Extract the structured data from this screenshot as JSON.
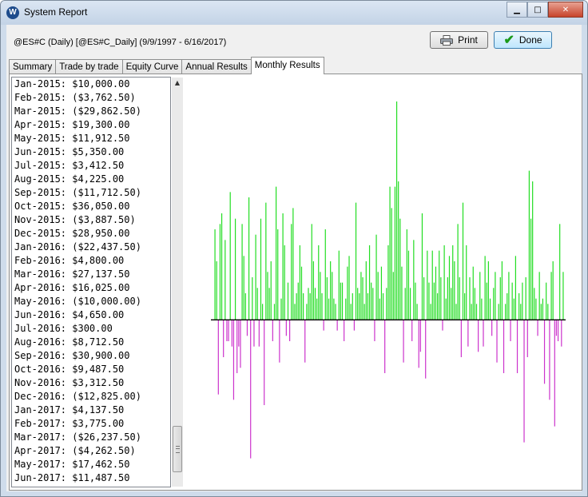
{
  "window": {
    "title": "System Report",
    "app_icon_letter": "W",
    "minimize_glyph": "▁",
    "maximize_glyph": "□",
    "close_glyph": "✕"
  },
  "header": {
    "subtitle": "@ES#C (Daily) [@ES#C_Daily]  (9/9/1997 - 6/16/2017)",
    "print_label": "Print",
    "done_label": "Done"
  },
  "tabs": [
    {
      "label": "Summary",
      "active": false
    },
    {
      "label": "Trade by trade",
      "active": false
    },
    {
      "label": "Equity Curve",
      "active": false
    },
    {
      "label": "Annual Results",
      "active": false
    },
    {
      "label": "Monthly Results",
      "active": true
    }
  ],
  "monthly_list": [
    "Jan-2015: $10,000.00",
    "Feb-2015: ($3,762.50)",
    "Mar-2015: ($29,862.50)",
    "Apr-2015: $19,300.00",
    "May-2015: $11,912.50",
    "Jun-2015: $5,350.00",
    "Jul-2015: $3,412.50",
    "Aug-2015: $4,225.00",
    "Sep-2015: ($11,712.50)",
    "Oct-2015: $36,050.00",
    "Nov-2015: ($3,887.50)",
    "Dec-2015: $28,950.00",
    "Jan-2016: ($22,437.50)",
    "Feb-2016: $4,800.00",
    "Mar-2016: $27,137.50",
    "Apr-2016: $16,025.00",
    "May-2016: ($10,000.00)",
    "Jun-2016: $4,650.00",
    "Jul-2016: $300.00",
    "Aug-2016: $8,712.50",
    "Sep-2016: $30,900.00",
    "Oct-2016: $9,487.50",
    "Nov-2016: $3,312.50",
    "Dec-2016: ($12,825.00)",
    "Jan-2017: $4,137.50",
    "Feb-2017: $3,775.00",
    "Mar-2017: ($26,237.50)",
    "Apr-2017: ($4,262.50)",
    "May-2017: $17,462.50",
    "Jun-2017: $11,487.50"
  ],
  "colors": {
    "positive_bar": "#22dd22",
    "negative_bar": "#cc33cc",
    "axis": "#000000"
  },
  "chart_data": {
    "type": "bar",
    "title": "",
    "xlabel": "",
    "ylabel": "",
    "ylim": [
      -140000,
      205000
    ],
    "grid": false,
    "values": [
      85000,
      55000,
      -70000,
      90000,
      100000,
      -35000,
      75000,
      -20000,
      -20000,
      120000,
      -25000,
      -75000,
      95000,
      -50000,
      -25000,
      -45000,
      90000,
      60000,
      25000,
      -15000,
      115000,
      -130000,
      40000,
      -25000,
      80000,
      30000,
      -25000,
      95000,
      15000,
      -80000,
      110000,
      45000,
      30000,
      55000,
      -20000,
      15000,
      125000,
      85000,
      -40000,
      20000,
      100000,
      70000,
      -15000,
      35000,
      -20000,
      90000,
      105000,
      15000,
      25000,
      35000,
      70000,
      50000,
      25000,
      -40000,
      15000,
      30000,
      25000,
      90000,
      55000,
      30000,
      20000,
      70000,
      45000,
      25000,
      -10000,
      85000,
      40000,
      20000,
      55000,
      45000,
      20000,
      15000,
      -10000,
      65000,
      35000,
      35000,
      -20000,
      20000,
      50000,
      60000,
      15000,
      25000,
      -10000,
      110000,
      30000,
      25000,
      45000,
      40000,
      15000,
      55000,
      25000,
      70000,
      35000,
      30000,
      -20000,
      80000,
      45000,
      20000,
      50000,
      25000,
      -50000,
      30000,
      70000,
      125000,
      105000,
      45000,
      125000,
      205000,
      130000,
      95000,
      50000,
      -40000,
      30000,
      85000,
      65000,
      30000,
      -20000,
      75000,
      35000,
      15000,
      -45000,
      -30000,
      100000,
      40000,
      -55000,
      65000,
      35000,
      15000,
      65000,
      35000,
      50000,
      25000,
      65000,
      40000,
      -10000,
      70000,
      20000,
      40000,
      60000,
      30000,
      70000,
      55000,
      15000,
      90000,
      40000,
      -35000,
      110000,
      25000,
      70000,
      -25000,
      40000,
      15000,
      50000,
      30000,
      15000,
      -30000,
      45000,
      20000,
      -25000,
      60000,
      35000,
      55000,
      20000,
      -15000,
      30000,
      45000,
      -40000,
      15000,
      40000,
      55000,
      -50000,
      15000,
      25000,
      45000,
      -20000,
      35000,
      20000,
      60000,
      -50000,
      25000,
      15000,
      35000,
      -115000,
      40000,
      -35000,
      140000,
      95000,
      130000,
      30000,
      20000,
      -15000,
      45000,
      15000,
      20000,
      -60000,
      35000,
      15000,
      -75000,
      45000,
      55000,
      -100000,
      -15000,
      -20000,
      90000,
      -25000,
      45000
    ]
  }
}
